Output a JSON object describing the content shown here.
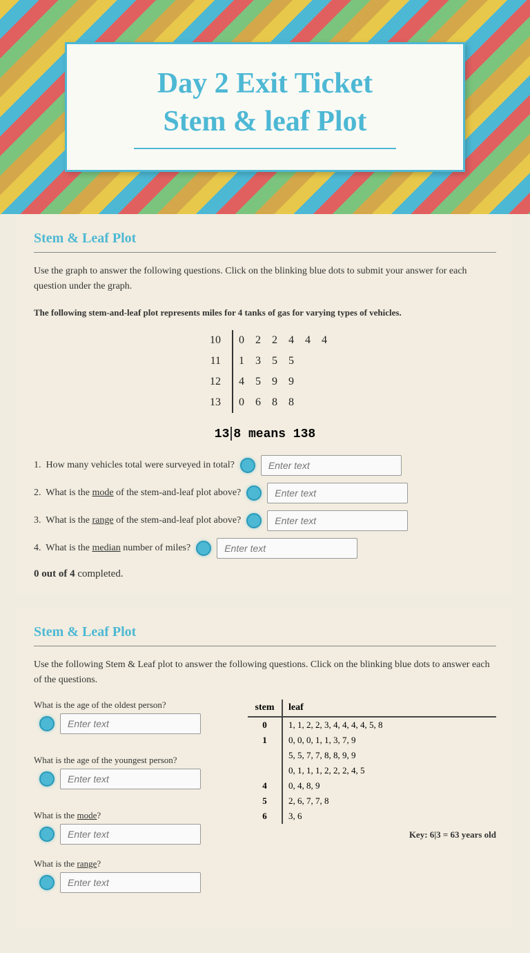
{
  "header": {
    "title_line1": "Day 2 Exit Ticket",
    "title_line2": "Stem & leaf Plot"
  },
  "section1": {
    "title": "Stem & Leaf Plot",
    "description": "Use the graph to answer the following questions.  Click on the blinking blue dots to submit your answer for each question under the graph.",
    "plot_description": "The following stem-and-leaf plot represents miles for 4 tanks of gas for varying types of vehicles.",
    "plot_rows": [
      {
        "stem": "10",
        "leaves": "0  2  2  4  4  4"
      },
      {
        "stem": "11",
        "leaves": "1  3  5  5"
      },
      {
        "stem": "12",
        "leaves": "4  5  9  9"
      },
      {
        "stem": "13",
        "leaves": "0  6  8  8"
      }
    ],
    "key_text": "13|8 means 138",
    "questions": [
      {
        "num": "1.",
        "text": "How many vehicles total were surveyed in total?",
        "placeholder": "Enter text"
      },
      {
        "num": "2.",
        "text": "What is the mode of the stem-and-leaf plot above?",
        "underline": "mode",
        "placeholder": "Enter text"
      },
      {
        "num": "3.",
        "text": "What is the range of the stem-and-leaf plot above?",
        "underline": "range",
        "placeholder": "Enter text"
      },
      {
        "num": "4.",
        "text": "What is the median number of miles?",
        "underline": "median",
        "placeholder": "Enter text"
      }
    ],
    "completion": {
      "count": "0 out of 4",
      "suffix": " completed."
    }
  },
  "section2": {
    "title": "Stem & Leaf Plot",
    "description": "Use the following Stem & Leaf plot to answer the following questions.  Click on the blinking blue dots to answer each of the questions.",
    "plot_headers": [
      "stem",
      "leaf"
    ],
    "plot_rows": [
      {
        "stem": "0",
        "leaf": "1, 1, 2, 2, 3, 4, 4, 4, 4, 5, 8"
      },
      {
        "stem": "1",
        "leaf": "0, 0, 0, 1, 1, 3, 7, 9"
      },
      {
        "stem": "",
        "leaf": "5, 5, 7, 7, 8, 8, 9, 9"
      },
      {
        "stem": "",
        "leaf": "0, 1, 1, 1, 2, 2, 2, 4, 5"
      },
      {
        "stem": "4",
        "leaf": "0, 4, 8, 9"
      },
      {
        "stem": "5",
        "leaf": "2, 6, 7, 7, 8"
      },
      {
        "stem": "6",
        "leaf": "3, 6"
      }
    ],
    "key_text": "Key: 6|3 = 63 years old",
    "questions": [
      {
        "label": "What is the age of the oldest person?",
        "placeholder": "Enter text"
      },
      {
        "label": "What is the age of the youngest person?",
        "placeholder": "Enter text"
      },
      {
        "label": "What is the mode?",
        "underline": "mode",
        "placeholder": "Enter text"
      },
      {
        "label": "What is the range?",
        "underline": "range",
        "placeholder": "Enter text"
      }
    ]
  }
}
